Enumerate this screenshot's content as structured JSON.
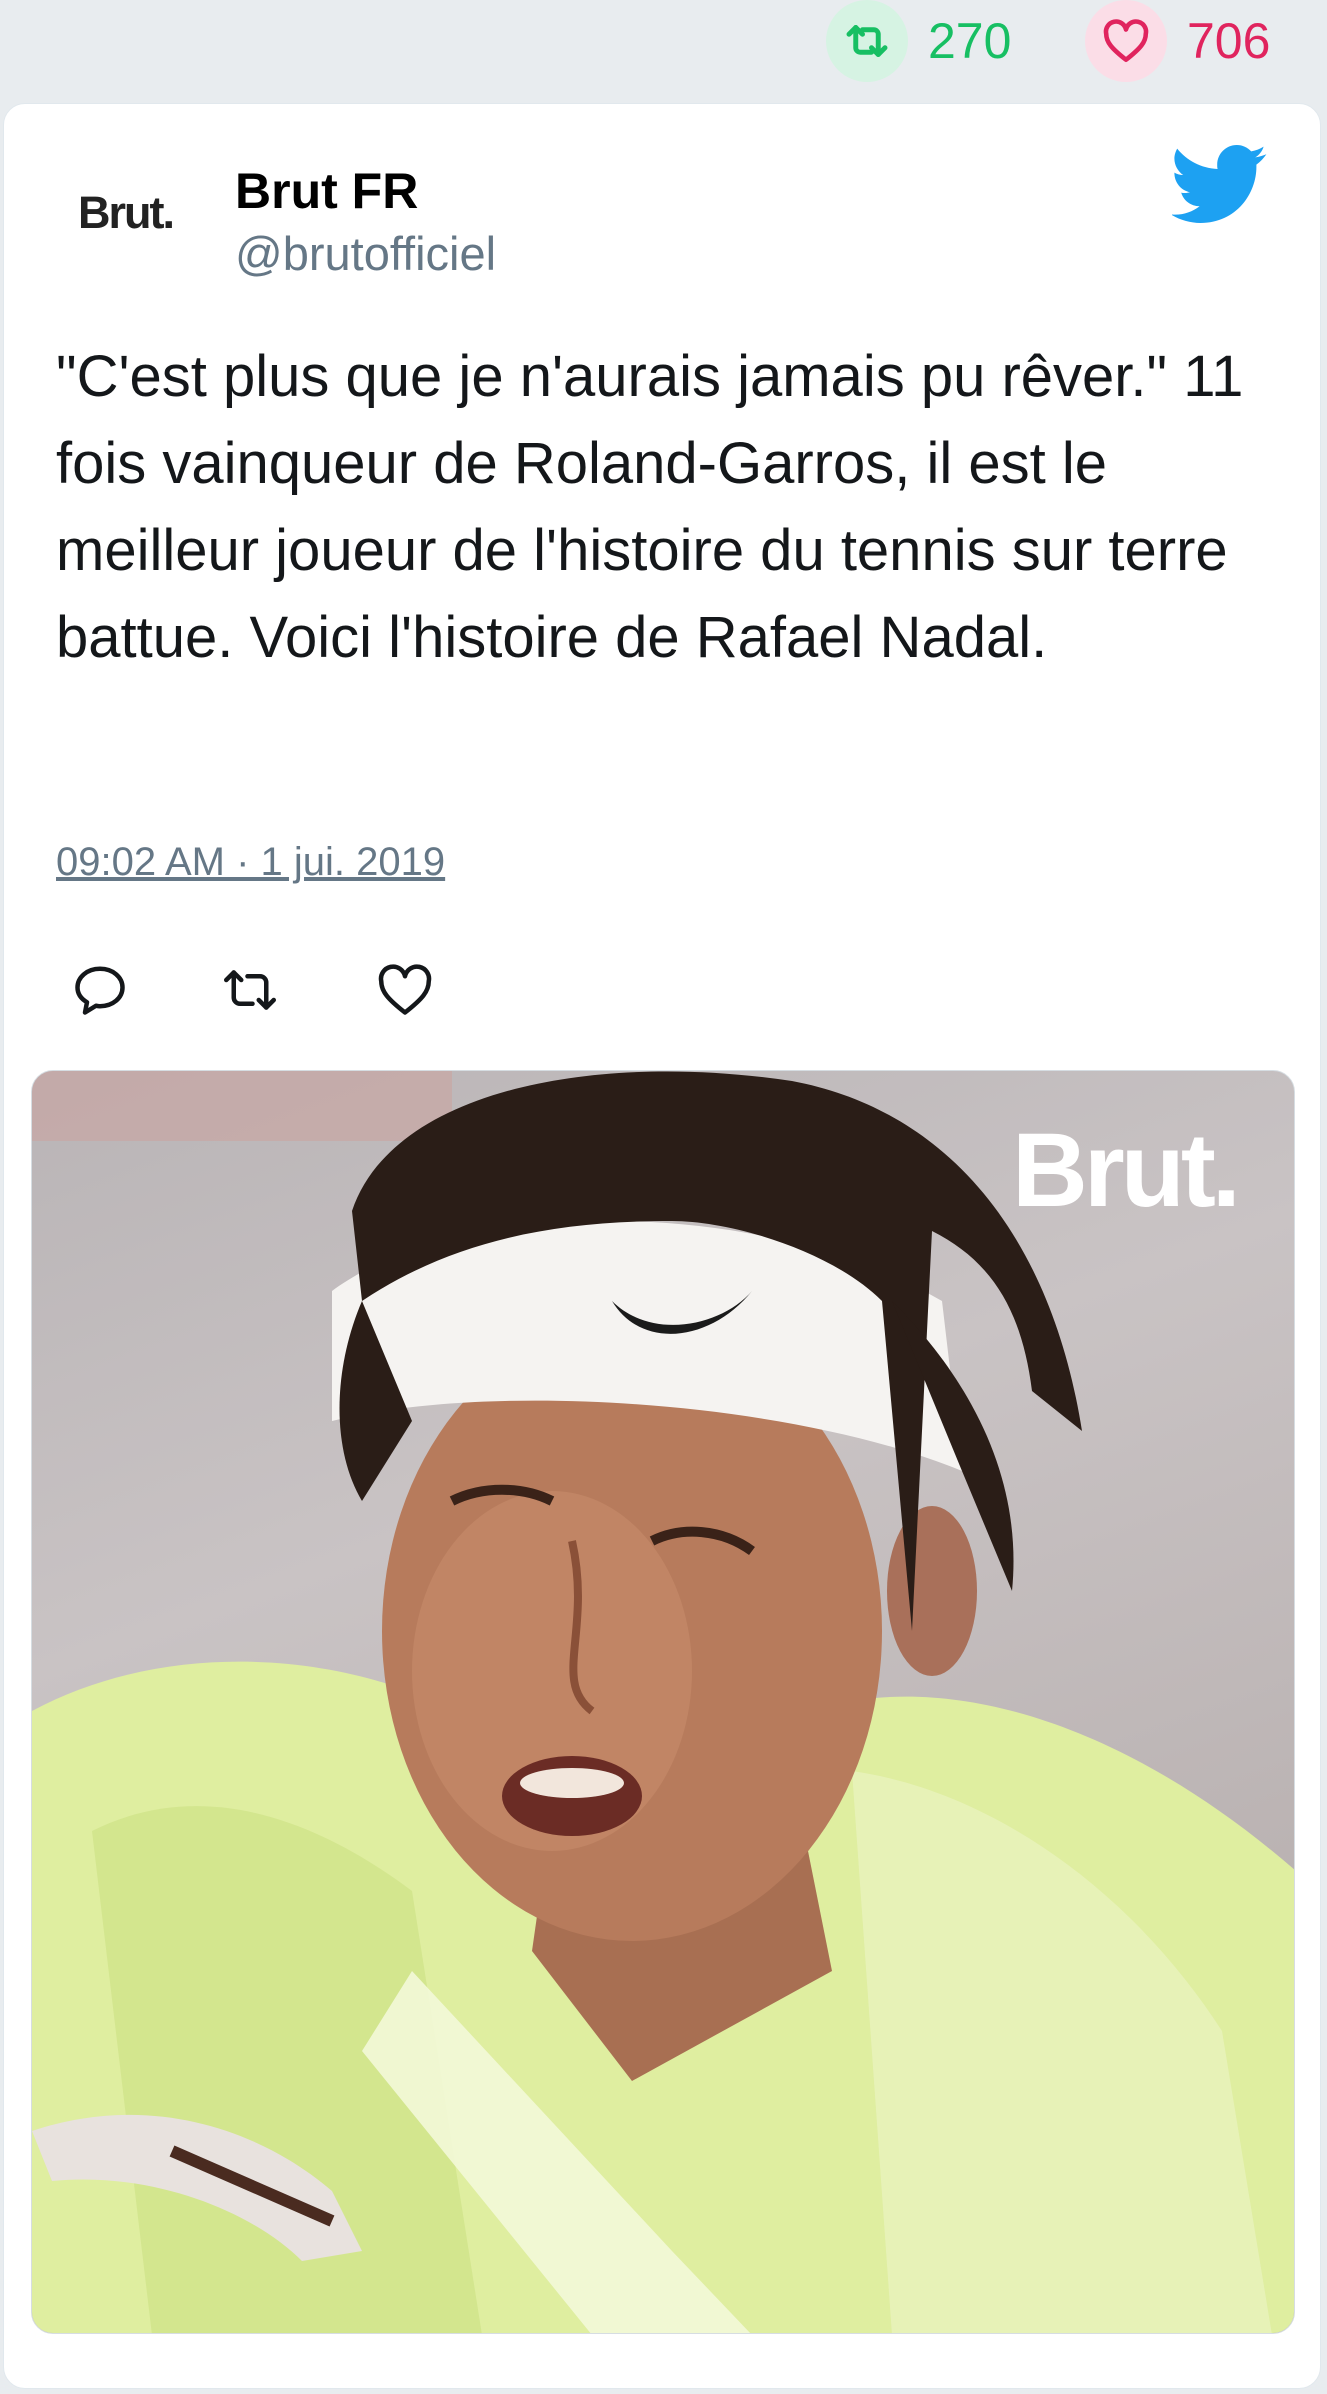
{
  "stats": {
    "retweets": "270",
    "likes": "706",
    "retweet_icon": "retweet-icon",
    "like_icon": "heart-icon",
    "retweet_color": "#17bf63",
    "like_color": "#e0245e"
  },
  "tweet": {
    "avatar_text": "Brut.",
    "author_name": "Brut FR",
    "author_handle": "@brutofficiel",
    "text": "\"C'est plus que je n'aurais jamais pu rêver.\" 11 fois vainqueur de Roland-Garros, il est le meilleur joueur de l'histoire du tennis sur terre battue. Voici l'histoire de Rafael Nadal.",
    "timestamp": "09:02 AM · 1 jui. 2019",
    "platform_icon": "twitter-bird-icon",
    "accent_color": "#1da1f2"
  },
  "actions": {
    "reply_icon": "reply-icon",
    "retweet_icon": "retweet-icon",
    "like_icon": "heart-icon"
  },
  "media": {
    "watermark": "Brut."
  }
}
